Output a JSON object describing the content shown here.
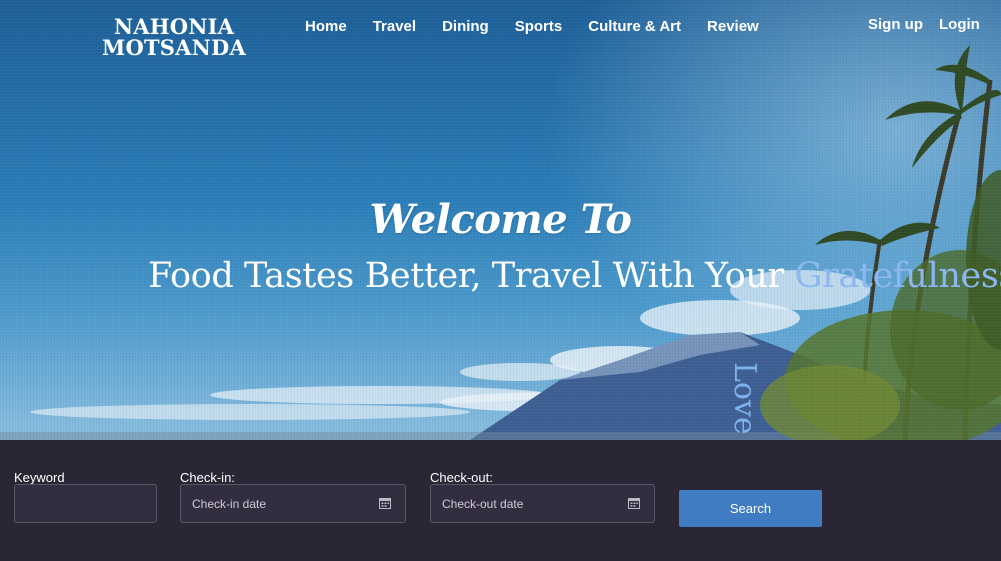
{
  "logo": {
    "line1": "NAHONIA",
    "line2": "MOTSANDA"
  },
  "nav": {
    "items": [
      "Home",
      "Travel",
      "Dining",
      "Sports",
      "Culture & Art",
      "Review"
    ]
  },
  "auth": {
    "signup": "Sign up",
    "login": "Login"
  },
  "hero": {
    "welcome": "Welcome To",
    "tagline_main": "Food Tastes Better, Travel With Your ",
    "tagline_accent": "Gratefulness",
    "vertical_word": "Love"
  },
  "search": {
    "keyword_label": "Keyword",
    "keyword_value": "",
    "checkin_label": "Check-in:",
    "checkin_placeholder": "Check-in date",
    "checkout_label": "Check-out:",
    "checkout_placeholder": "Check-out date",
    "button_label": "Search"
  },
  "colors": {
    "accent": "#8cb7f2",
    "button": "#3f7cc1",
    "panel": "#2b2636"
  },
  "icons": {
    "calendar": "calendar-icon"
  }
}
